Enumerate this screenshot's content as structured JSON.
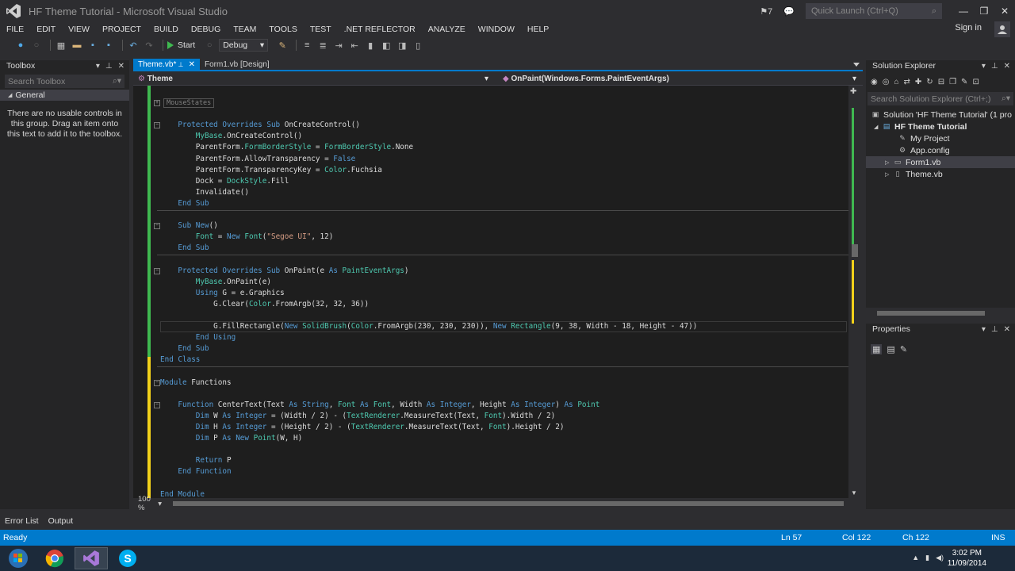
{
  "window": {
    "title": "HF Theme Tutorial - Microsoft Visual Studio",
    "notification_count": "7",
    "quick_launch_placeholder": "Quick Launch (Ctrl+Q)",
    "sign_in": "Sign in"
  },
  "menu": [
    "FILE",
    "EDIT",
    "VIEW",
    "PROJECT",
    "BUILD",
    "DEBUG",
    "TEAM",
    "TOOLS",
    "TEST",
    ".NET REFLECTOR",
    "ANALYZE",
    "WINDOW",
    "HELP"
  ],
  "toolbar": {
    "start_label": "Start",
    "config_value": "Debug"
  },
  "toolbox": {
    "title": "Toolbox",
    "search_placeholder": "Search Toolbox",
    "group": "General",
    "message": "There are no usable controls in this group. Drag an item onto this text to add it to the toolbox."
  },
  "editor": {
    "tabs": [
      {
        "label": "Theme.vb*",
        "active": true
      },
      {
        "label": "Form1.vb [Design]",
        "active": false
      }
    ],
    "nav_class": "Theme",
    "nav_member": "OnPaint(Windows.Forms.PaintEventArgs)",
    "zoom": "100 %",
    "lines": [
      {
        "text": "    MouseStates",
        "region": true
      },
      {
        "text": ""
      },
      {
        "text": "    Protected Overrides Sub OnCreateControl()"
      },
      {
        "text": "        MyBase.OnCreateControl()"
      },
      {
        "text": "        ParentForm.FormBorderStyle = FormBorderStyle.None"
      },
      {
        "text": "        ParentForm.AllowTransparency = False"
      },
      {
        "text": "        ParentForm.TransparencyKey = Color.Fuchsia"
      },
      {
        "text": "        Dock = DockStyle.Fill"
      },
      {
        "text": "        Invalidate()"
      },
      {
        "text": "    End Sub"
      },
      {
        "text": ""
      },
      {
        "text": "    Sub New()"
      },
      {
        "text": "        Font = New Font(\"Segoe UI\", 12)"
      },
      {
        "text": "    End Sub"
      },
      {
        "text": ""
      },
      {
        "text": "    Protected Overrides Sub OnPaint(e As PaintEventArgs)"
      },
      {
        "text": "        MyBase.OnPaint(e)"
      },
      {
        "text": "        Using G = e.Graphics"
      },
      {
        "text": "            G.Clear(Color.FromArgb(32, 32, 36))"
      },
      {
        "text": ""
      },
      {
        "text": "            G.FillRectangle(New SolidBrush(Color.FromArgb(230, 230, 230)), New Rectangle(9, 38, Width - 18, Height - 47))"
      },
      {
        "text": "        End Using"
      },
      {
        "text": "    End Sub"
      },
      {
        "text": "End Class"
      },
      {
        "text": ""
      },
      {
        "text": "Module Functions"
      },
      {
        "text": ""
      },
      {
        "text": "    Function CenterText(Text As String, Font As Font, Width As Integer, Height As Integer) As Point"
      },
      {
        "text": "        Dim W As Integer = (Width / 2) - (TextRenderer.MeasureText(Text, Font).Width / 2)"
      },
      {
        "text": "        Dim H As Integer = (Height / 2) - (TextRenderer.MeasureText(Text, Font).Height / 2)"
      },
      {
        "text": "        Dim P As New Point(W, H)"
      },
      {
        "text": ""
      },
      {
        "text": "        Return P"
      },
      {
        "text": "    End Function"
      },
      {
        "text": ""
      },
      {
        "text": "End Module"
      }
    ]
  },
  "solution_explorer": {
    "title": "Solution Explorer",
    "search_placeholder": "Search Solution Explorer (Ctrl+;)",
    "items": [
      {
        "label": "Solution 'HF Theme Tutorial' (1 pro"
      },
      {
        "label": "HF Theme Tutorial"
      },
      {
        "label": "My Project"
      },
      {
        "label": "App.config"
      },
      {
        "label": "Form1.vb"
      },
      {
        "label": "Theme.vb"
      }
    ]
  },
  "properties": {
    "title": "Properties"
  },
  "bottom_tabs": [
    "Error List",
    "Output"
  ],
  "status": {
    "text": "Ready",
    "ln": "Ln 57",
    "col": "Col 122",
    "ch": "Ch 122",
    "mode": "INS"
  },
  "taskbar": {
    "time": "3:02 PM",
    "date": "11/09/2014"
  },
  "colors": {
    "accent": "#007acc",
    "background": "#2d2d30",
    "editor": "#1e1e1e",
    "keyword": "#569cd6",
    "type": "#4ec9b0",
    "string": "#d69d85"
  }
}
